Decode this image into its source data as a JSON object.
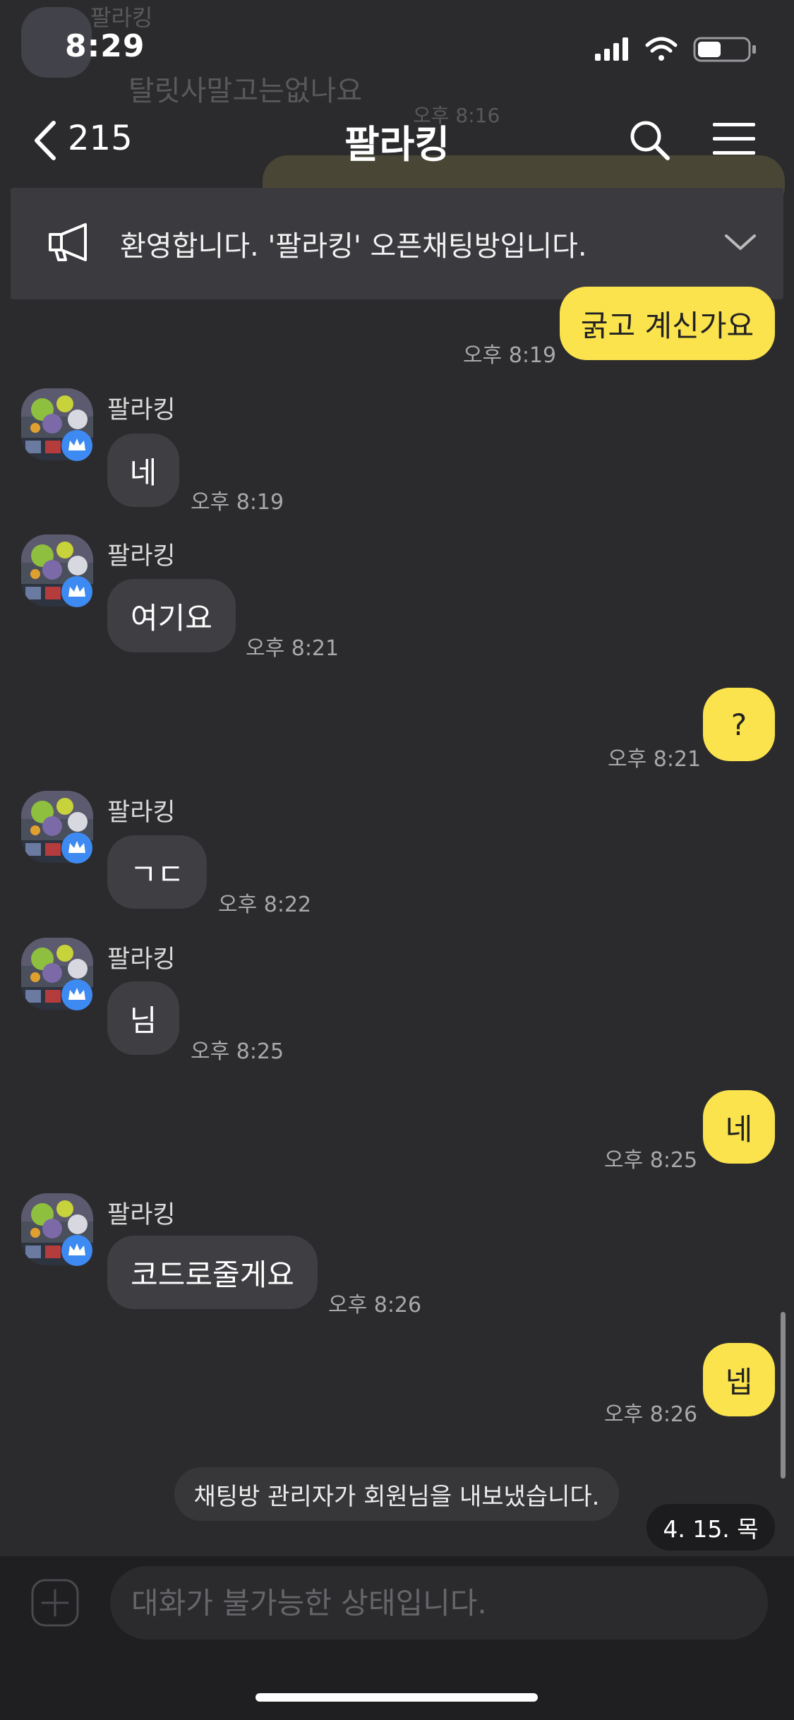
{
  "status_bar": {
    "time": "8:29"
  },
  "ghost": {
    "name": "팔라킹",
    "message": "탈릿사말고는없나요",
    "time": "오후 8:16"
  },
  "header": {
    "back_count": "215",
    "title": "팔라킹"
  },
  "notice": {
    "text": "환영합니다. '팔라킹' 오픈채팅방입니다."
  },
  "messages": [
    {
      "side": "mine",
      "text": "굵고 계신가요",
      "time": "오후 8:19"
    },
    {
      "side": "other",
      "name": "팔라킹",
      "text": "네",
      "time": "오후 8:19"
    },
    {
      "side": "other",
      "name": "팔라킹",
      "text": "여기요",
      "time": "오후 8:21"
    },
    {
      "side": "mine",
      "text": "?",
      "time": "오후 8:21"
    },
    {
      "side": "other",
      "name": "팔라킹",
      "text": "ㄱㄷ",
      "time": "오후 8:22"
    },
    {
      "side": "other",
      "name": "팔라킹",
      "text": "님",
      "time": "오후 8:25"
    },
    {
      "side": "mine",
      "text": "네",
      "time": "오후 8:25"
    },
    {
      "side": "other",
      "name": "팔라킹",
      "text": "코드로줄게요",
      "time": "오후 8:26"
    },
    {
      "side": "mine",
      "text": "넵",
      "time": "오후 8:26"
    }
  ],
  "system_message": "채팅방 관리자가 회원님을 내보냈습니다.",
  "date_pill": "4. 15. 목",
  "input": {
    "placeholder": "대화가 불가능한 상태입니다."
  },
  "colors": {
    "background": "#2b2b2d",
    "my_bubble": "#fae34d",
    "other_bubble": "#3f3f43",
    "badge": "#3d8bf2"
  },
  "icons": [
    "back-chevron-icon",
    "search-icon",
    "menu-icon",
    "megaphone-icon",
    "chevron-down-icon",
    "crown-badge-icon",
    "plus-icon",
    "wifi-icon",
    "signal-icon",
    "battery-icon"
  ]
}
